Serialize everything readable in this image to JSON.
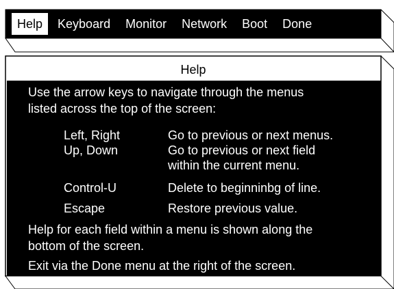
{
  "menubar": {
    "items": [
      {
        "label": "Help",
        "active": true
      },
      {
        "label": "Keyboard",
        "active": false
      },
      {
        "label": "Monitor",
        "active": false
      },
      {
        "label": "Network",
        "active": false
      },
      {
        "label": "Boot",
        "active": false
      },
      {
        "label": "Done",
        "active": false
      }
    ]
  },
  "panel": {
    "title": "Help",
    "intro_line1": "Use the arrow keys to navigate through the menus",
    "intro_line2": "listed across the top of the screen:",
    "keys": [
      {
        "key": "Left, Right",
        "desc_line1": "Go to previous or next menus.",
        "desc_line2": ""
      },
      {
        "key": "Up, Down",
        "desc_line1": "Go to previous or next field",
        "desc_line2": "within the current menu."
      },
      {
        "key": "Control-U",
        "desc_line1": "Delete to beginninbg of line.",
        "desc_line2": ""
      },
      {
        "key": "Escape",
        "desc_line1": "Restore previous value.",
        "desc_line2": ""
      }
    ],
    "help_line1": "Help for each field within a menu is shown along the",
    "help_line2": "bottom of the screen.",
    "exit_line": "Exit via the Done menu at the right of the screen."
  },
  "colors": {
    "background": "#ffffff",
    "screen": "#000000",
    "text_on_dark": "#ffffff",
    "highlight": "#ffffff"
  }
}
